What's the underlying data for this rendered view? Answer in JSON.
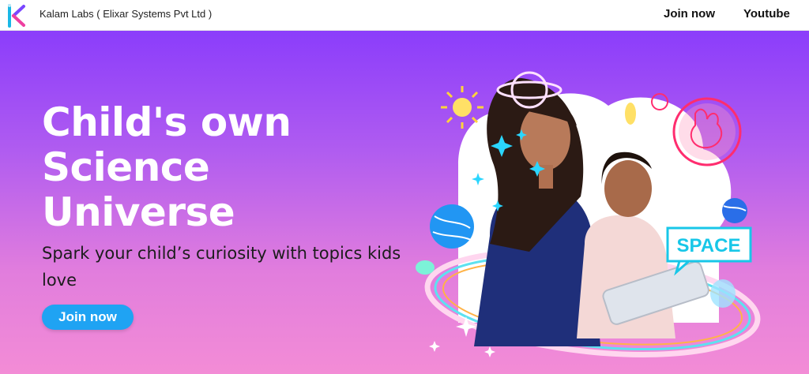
{
  "header": {
    "brand": "Kalam Labs ( Elixar Systems Pvt Ltd )",
    "nav": [
      {
        "label": "Join now"
      },
      {
        "label": "Youtube"
      }
    ]
  },
  "hero": {
    "headline_lines": [
      "Child's own",
      "Science",
      "Universe"
    ],
    "subtext": "Spark your child’s curiosity with topics kids love",
    "cta_label": "Join now",
    "badge_text": "SPACE"
  },
  "colors": {
    "gradient_top": "#8b3dfb",
    "gradient_bottom": "#f38cd6",
    "cta": "#1fa3f3",
    "accent_cyan": "#18c7e8"
  },
  "icons": [
    "kalam-logo-icon",
    "planet-icon",
    "sun-icon",
    "sparkle-icon",
    "rabbit-moon-icon"
  ]
}
